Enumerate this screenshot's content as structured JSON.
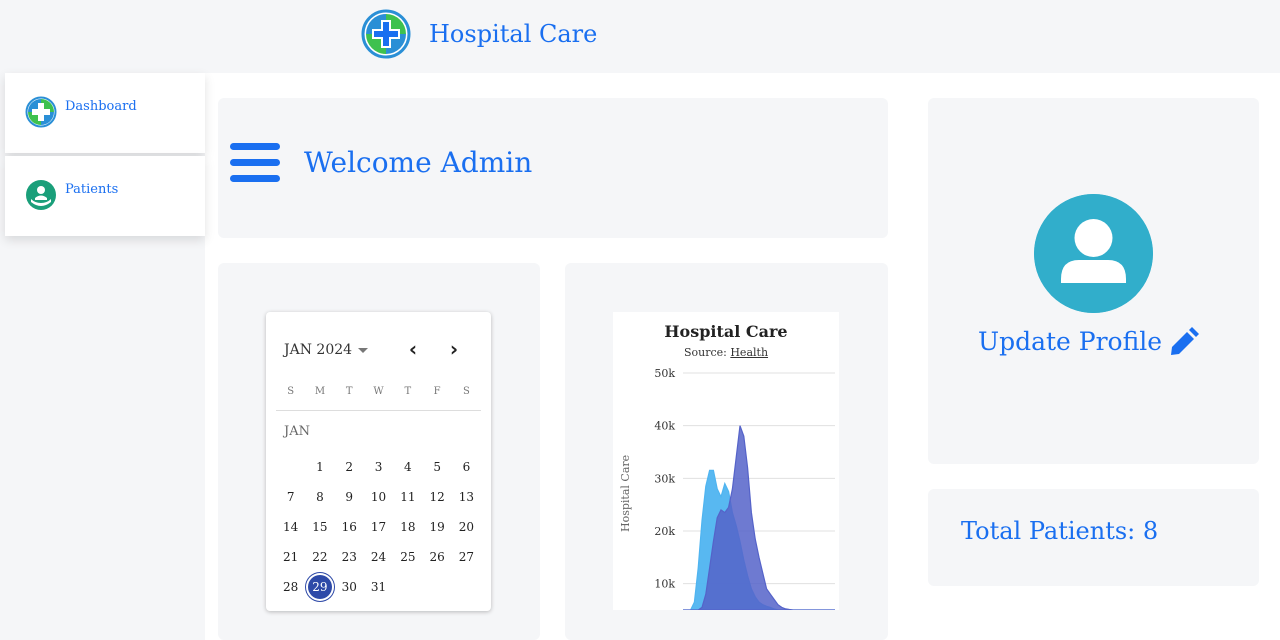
{
  "app": {
    "name": "Hospital Care"
  },
  "sidebar": {
    "items": [
      {
        "label": "Dashboard",
        "icon": "hospital-logo-icon"
      },
      {
        "label": "Patients",
        "icon": "patient-care-icon"
      }
    ]
  },
  "welcome": {
    "text": "Welcome Admin"
  },
  "calendar": {
    "month_year": "JAN 2024",
    "month_label": "JAN",
    "weekdays": [
      "S",
      "M",
      "T",
      "W",
      "T",
      "F",
      "S"
    ],
    "days": [
      1,
      2,
      3,
      4,
      5,
      6,
      7,
      8,
      9,
      10,
      11,
      12,
      13,
      14,
      15,
      16,
      17,
      18,
      19,
      20,
      21,
      22,
      23,
      24,
      25,
      26,
      27,
      28,
      29,
      30,
      31
    ],
    "first_weekday_index": 1,
    "selected_day": 29
  },
  "chart": {
    "title": "Hospital Care",
    "source_prefix": "Source:",
    "source_link": "Health",
    "ylabel": "Hospital Care",
    "ytick_labels": [
      "50k",
      "40k",
      "30k",
      "20k",
      "10k"
    ]
  },
  "chart_data": {
    "type": "area",
    "title": "Hospital Care",
    "subtitle": "Source: Health",
    "ylabel": "Hospital Care",
    "ylim": [
      5000,
      50000
    ],
    "yticks": [
      10000,
      20000,
      30000,
      40000,
      50000
    ],
    "grid": true,
    "x": [
      0,
      1,
      2,
      3,
      4,
      5,
      6,
      7,
      8,
      9,
      10,
      11,
      12,
      13,
      14,
      15,
      16,
      17,
      18,
      19,
      20,
      21,
      22,
      23,
      24,
      25,
      26,
      27,
      28,
      29,
      30,
      31,
      32,
      33,
      34,
      35,
      36,
      37,
      38,
      39,
      40
    ],
    "series": [
      {
        "color": "#4fb4f0",
        "values": [
          5000,
          5000,
          5000,
          6500,
          13000,
          22000,
          28500,
          31500,
          31500,
          28000,
          26500,
          29000,
          27500,
          23500,
          21000,
          18000,
          14500,
          11500,
          9000,
          7500,
          6500,
          6000,
          5700,
          5500,
          5200,
          5000,
          5000,
          5000,
          5000,
          5000,
          5000,
          5000,
          5000,
          5000,
          5000,
          5000,
          5000,
          5000,
          5000,
          5000,
          5000
        ]
      },
      {
        "color": "#5563c9",
        "values": [
          5000,
          5000,
          5000,
          5000,
          5000,
          5500,
          8000,
          13000,
          18000,
          22500,
          24000,
          23500,
          24500,
          28000,
          34000,
          40000,
          38000,
          32000,
          23500,
          18500,
          15000,
          12000,
          9000,
          8000,
          7000,
          6000,
          5500,
          5200,
          5100,
          5000,
          5000,
          5000,
          5000,
          5000,
          5000,
          5000,
          5000,
          5000,
          5000,
          5000,
          5000
        ]
      }
    ]
  },
  "profile": {
    "update_label": "Update Profile"
  },
  "stats": {
    "total_patients": "Total Patients: 8"
  },
  "colors": {
    "accent": "#1a6ff0",
    "avatar_bg": "#31aecb",
    "card_bg": "#f5f6f8",
    "selected_day": "#2e4aa8"
  }
}
